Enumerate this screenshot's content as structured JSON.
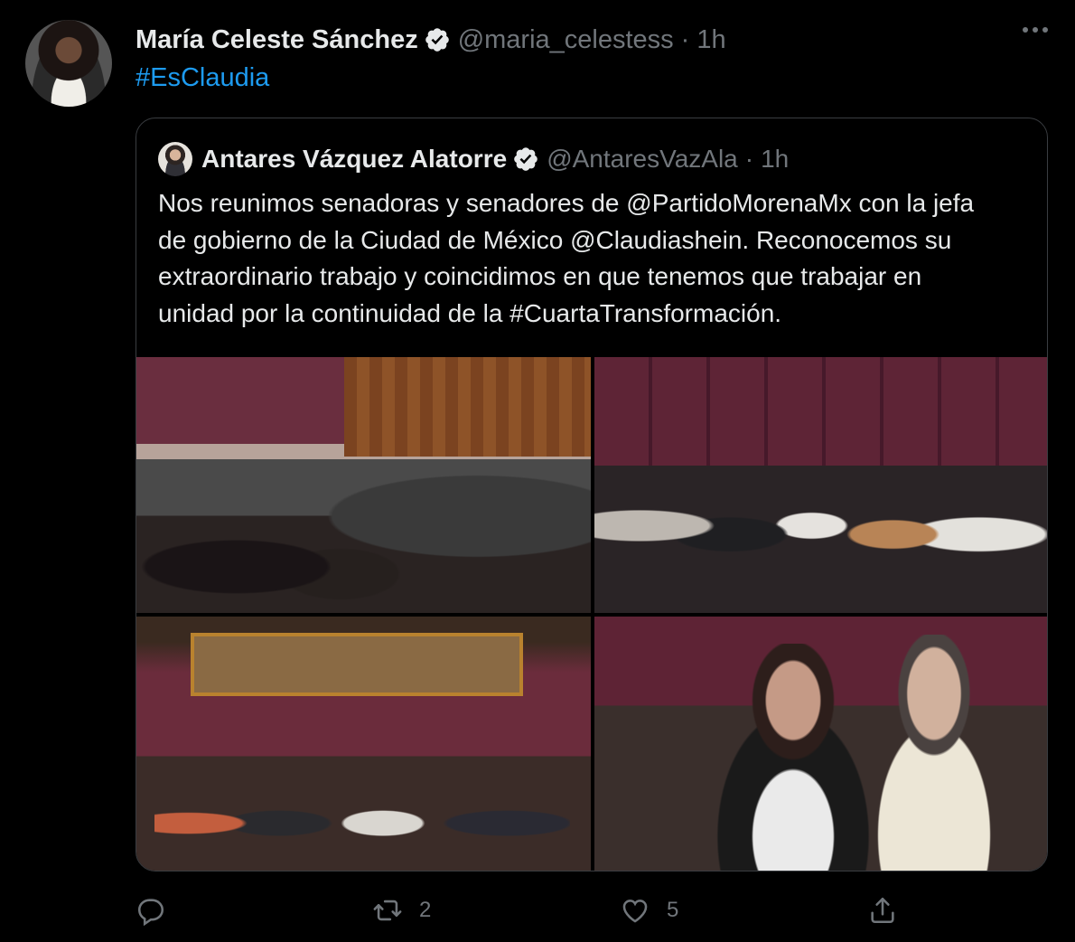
{
  "tweet": {
    "author_name": "María Celeste Sánchez",
    "author_handle": "@maria_celestess",
    "separator": "·",
    "time": "1h",
    "text": "#EsClaudia"
  },
  "quoted": {
    "author_name": "Antares Vázquez Alatorre",
    "author_handle": "@AntaresVazAla",
    "separator": "·",
    "time": "1h",
    "text": "Nos reunimos senadoras y senadores de @PartidoMorenaMx con la jefa\nde gobierno de la Ciudad de México @Claudiashein. Reconocemos su\nextraordinario trabajo y coincidimos en que tenemos que trabajar en\nunidad por la continuidad de la #CuartaTransformación."
  },
  "actions": {
    "reply_count": "",
    "retweet_count": "2",
    "like_count": "5"
  },
  "colors": {
    "background": "#000000",
    "text": "#e7e9ea",
    "muted": "#71767b",
    "link": "#1d9bf0"
  }
}
